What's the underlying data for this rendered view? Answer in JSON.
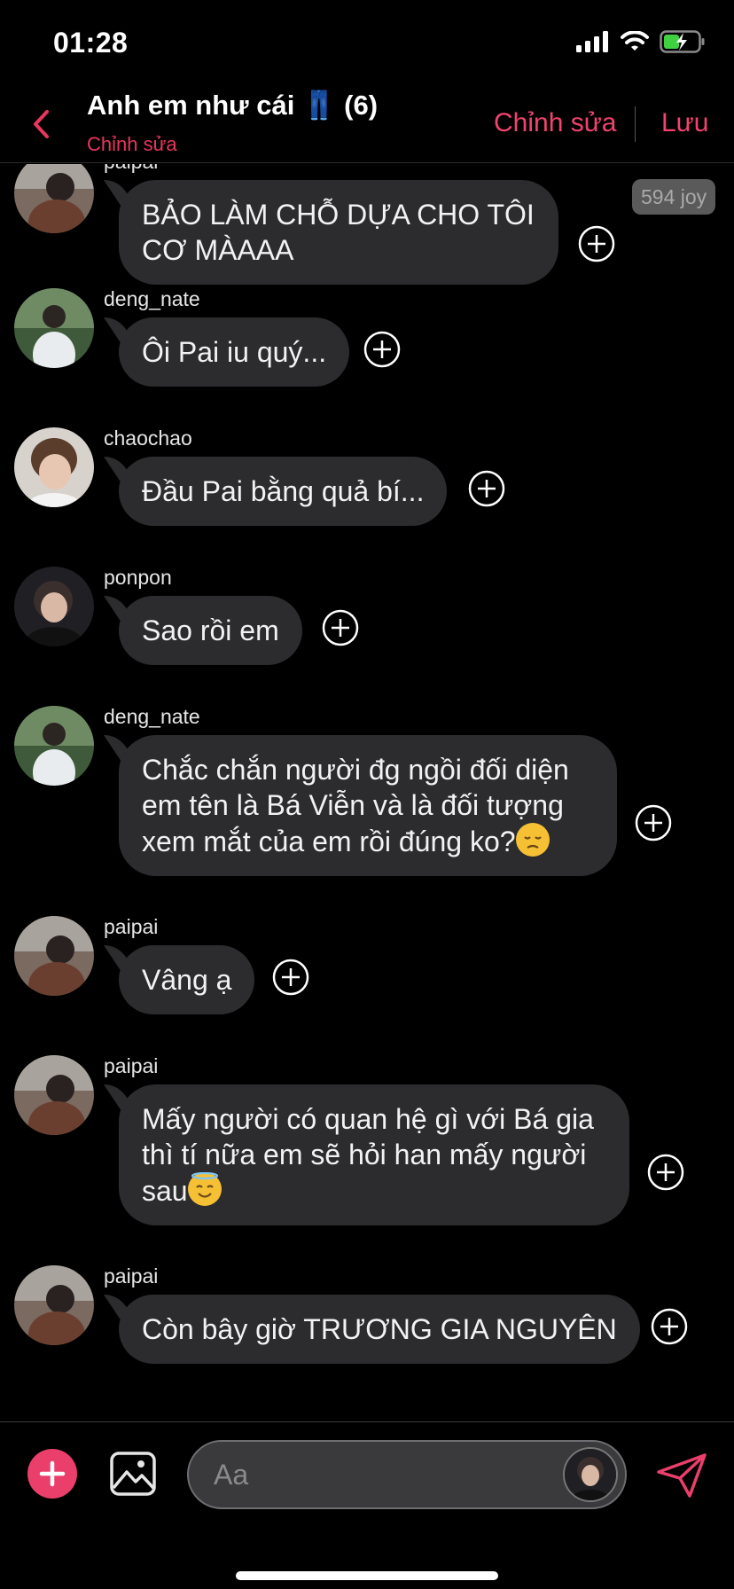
{
  "status_bar": {
    "time": "01:28"
  },
  "header": {
    "title": "Anh em như cái 👖 (6)",
    "subtitle": "Chỉnh sửa",
    "edit_label": "Chỉnh sửa",
    "save_label": "Lưu"
  },
  "joy_badge": "594 joy",
  "messages": [
    {
      "user": "paipai",
      "lines": [
        "BẢO LÀM CHỖ DỰA CHO TÔI",
        "CƠ MÀAAA"
      ]
    },
    {
      "user": "deng_nate",
      "lines": [
        "Ôi Pai iu quý..."
      ]
    },
    {
      "user": "chaochao",
      "lines": [
        "Đầu Pai bằng quả bí..."
      ]
    },
    {
      "user": "ponpon",
      "lines": [
        "Sao rồi em"
      ]
    },
    {
      "user": "deng_nate",
      "lines": [
        "Chắc chắn người đg ngồi đối diện",
        "em tên là Bá Viễn và là đối tượng",
        "xem mắt của em rồi đúng ko?"
      ],
      "emoji": "disappointed-face"
    },
    {
      "user": "paipai",
      "lines": [
        "Vâng ạ"
      ]
    },
    {
      "user": "paipai",
      "lines": [
        "Mấy người có quan hệ gì với Bá gia",
        "thì tí nữa em sẽ hỏi han mấy người",
        "sau"
      ],
      "emoji": "smiling-face-with-halo"
    },
    {
      "user": "paipai",
      "lines": [
        "Còn bây giờ TRƯƠNG GIA NGUYÊN"
      ]
    }
  ],
  "input": {
    "placeholder": "Aa"
  },
  "colors": {
    "accent": "#f2436e",
    "bubble": "#2c2c2e",
    "background": "#000000"
  }
}
